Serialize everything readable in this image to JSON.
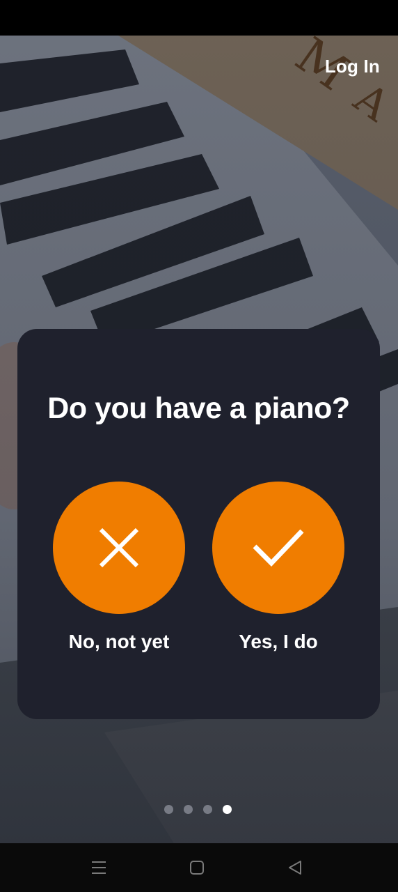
{
  "header": {
    "login_label": "Log In"
  },
  "card": {
    "title": "Do you have a piano?",
    "options": [
      {
        "label": "No, not yet",
        "icon": "close-icon"
      },
      {
        "label": "Yes, I do",
        "icon": "check-icon"
      }
    ]
  },
  "pagination": {
    "total": 4,
    "active_index": 3
  },
  "colors": {
    "accent": "#f07d00",
    "card_background": "#1f212d",
    "text": "#ffffff"
  },
  "system_nav": {
    "buttons": [
      "menu-icon",
      "home-icon",
      "back-icon"
    ]
  }
}
